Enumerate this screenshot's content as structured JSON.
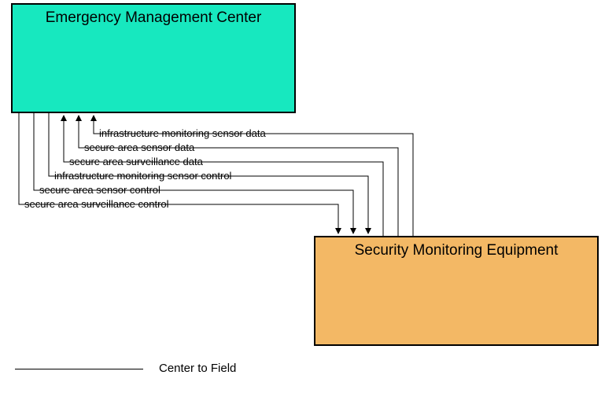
{
  "nodes": {
    "emc": {
      "title": "Emergency Management Center"
    },
    "sme": {
      "title": "Security Monitoring Equipment"
    }
  },
  "flows": [
    {
      "label": "infrastructure monitoring sensor data"
    },
    {
      "label": "secure area sensor data"
    },
    {
      "label": "secure area surveillance data"
    },
    {
      "label": "infrastructure monitoring sensor control"
    },
    {
      "label": "secure area sensor control"
    },
    {
      "label": "secure area surveillance control"
    }
  ],
  "legend": {
    "label": "Center to Field"
  },
  "chart_data": {
    "type": "diagram",
    "title": "",
    "nodes": [
      {
        "id": "emc",
        "label": "Emergency Management Center",
        "color": "#17e8bf"
      },
      {
        "id": "sme",
        "label": "Security Monitoring Equipment",
        "color": "#f3b865"
      }
    ],
    "edges": [
      {
        "from": "sme",
        "to": "emc",
        "label": "infrastructure monitoring sensor data"
      },
      {
        "from": "sme",
        "to": "emc",
        "label": "secure area sensor data"
      },
      {
        "from": "sme",
        "to": "emc",
        "label": "secure area surveillance data"
      },
      {
        "from": "emc",
        "to": "sme",
        "label": "infrastructure monitoring sensor control"
      },
      {
        "from": "emc",
        "to": "sme",
        "label": "secure area sensor control"
      },
      {
        "from": "emc",
        "to": "sme",
        "label": "secure area surveillance control"
      }
    ],
    "legend": [
      {
        "style": "solid",
        "label": "Center to Field"
      }
    ]
  }
}
